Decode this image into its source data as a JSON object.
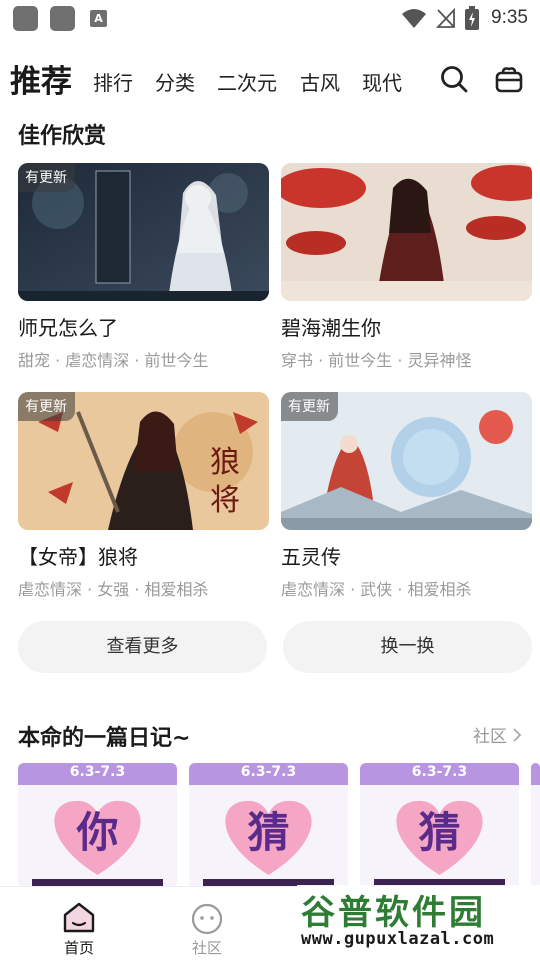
{
  "status_bar": {
    "time": "9:35"
  },
  "nav": {
    "active_tab": "推荐",
    "tabs": [
      "排行",
      "分类",
      "二次元",
      "古风",
      "现代"
    ]
  },
  "featured": {
    "title": "佳作欣赏",
    "cards": [
      {
        "title": "师兄怎么了",
        "tags": "甜宠 · 虐恋情深 · 前世今生",
        "badge": "有更新"
      },
      {
        "title": "碧海潮生你",
        "tags": "穿书 · 前世今生 · 灵异神怪",
        "badge": ""
      },
      {
        "title": "【女帝】狼将",
        "tags": "虐恋情深 · 女强 · 相爱相杀",
        "badge": "有更新"
      },
      {
        "title": "五灵传",
        "tags": "虐恋情深 · 武侠 · 相爱相杀",
        "badge": "有更新"
      }
    ],
    "buttons": {
      "more": "查看更多",
      "refresh": "换一换"
    }
  },
  "diary_section": {
    "title": "本命的一篇日记~",
    "link": "社区",
    "cards": [
      {
        "date": "6.3-7.3",
        "char": "你"
      },
      {
        "date": "6.3-7.3",
        "char": "猜"
      },
      {
        "date": "6.3-7.3",
        "char": "猜"
      }
    ]
  },
  "bottom_nav": {
    "home": "首页",
    "community": "社区"
  },
  "watermark": {
    "title": "谷普软件园",
    "url": "www.gupuxlazal.com"
  },
  "colors": {
    "accent": "#5a2b8a",
    "diary_header": "#b795e0",
    "heart": "#f5a6c5",
    "watermark": "#2f7d34"
  }
}
